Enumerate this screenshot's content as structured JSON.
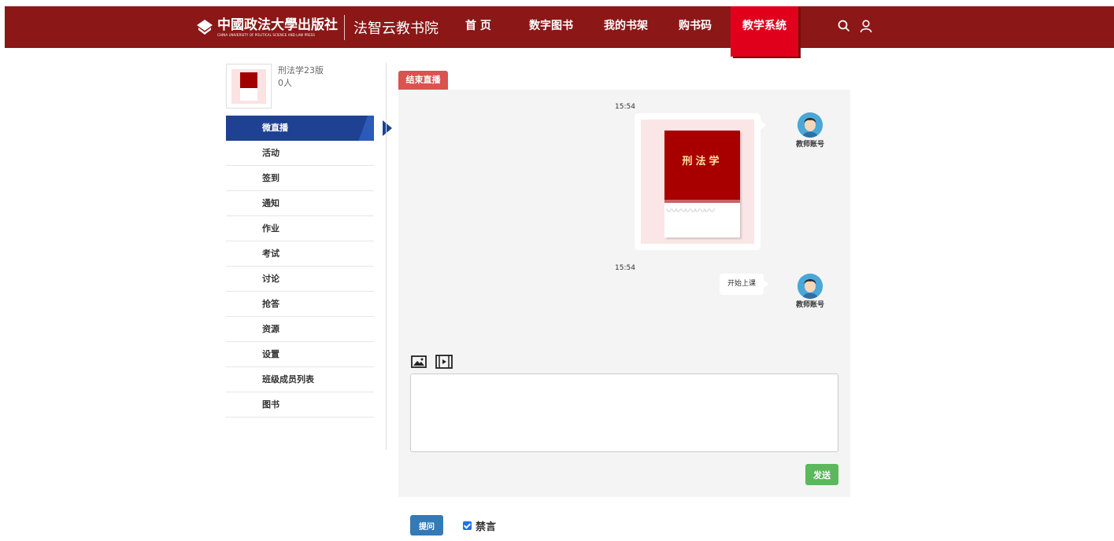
{
  "header": {
    "brand_name": "中國政法大學出版社",
    "brand_sub": "CHINA UNIVERSITY OF POLITICAL SCIENCE AND LAW PRESS",
    "site_name": "法智云教书院",
    "nav": [
      {
        "label": "首  页"
      },
      {
        "label": "数字图书"
      },
      {
        "label": "我的书架"
      },
      {
        "label": "购书码"
      },
      {
        "label": "教学系统",
        "active": true
      }
    ],
    "icons": [
      "search-icon",
      "user-icon"
    ],
    "bg_color": "#8b1717",
    "active_color": "#e0001b"
  },
  "course": {
    "title": "刑法学23版",
    "count": "0人"
  },
  "menu": [
    {
      "label": "微直播",
      "active": true
    },
    {
      "label": "活动"
    },
    {
      "label": "签到"
    },
    {
      "label": "通知"
    },
    {
      "label": "作业"
    },
    {
      "label": "考试"
    },
    {
      "label": "讨论"
    },
    {
      "label": "抢答"
    },
    {
      "label": "资源"
    },
    {
      "label": "设置"
    },
    {
      "label": "班级成员列表"
    },
    {
      "label": "图书"
    }
  ],
  "live": {
    "end_button": "结束直播",
    "messages": [
      {
        "time": "15:54",
        "sender": "教师账号",
        "type": "image",
        "cover_title": "刑法学"
      },
      {
        "time": "15:54",
        "sender": "教师账号",
        "type": "text",
        "text": "开始上课"
      }
    ],
    "tools": [
      "image-icon",
      "video-icon"
    ],
    "input_value": "",
    "send_button": "发送",
    "ask_button": "提问",
    "mute_label": "禁言",
    "mute_checked": true
  }
}
